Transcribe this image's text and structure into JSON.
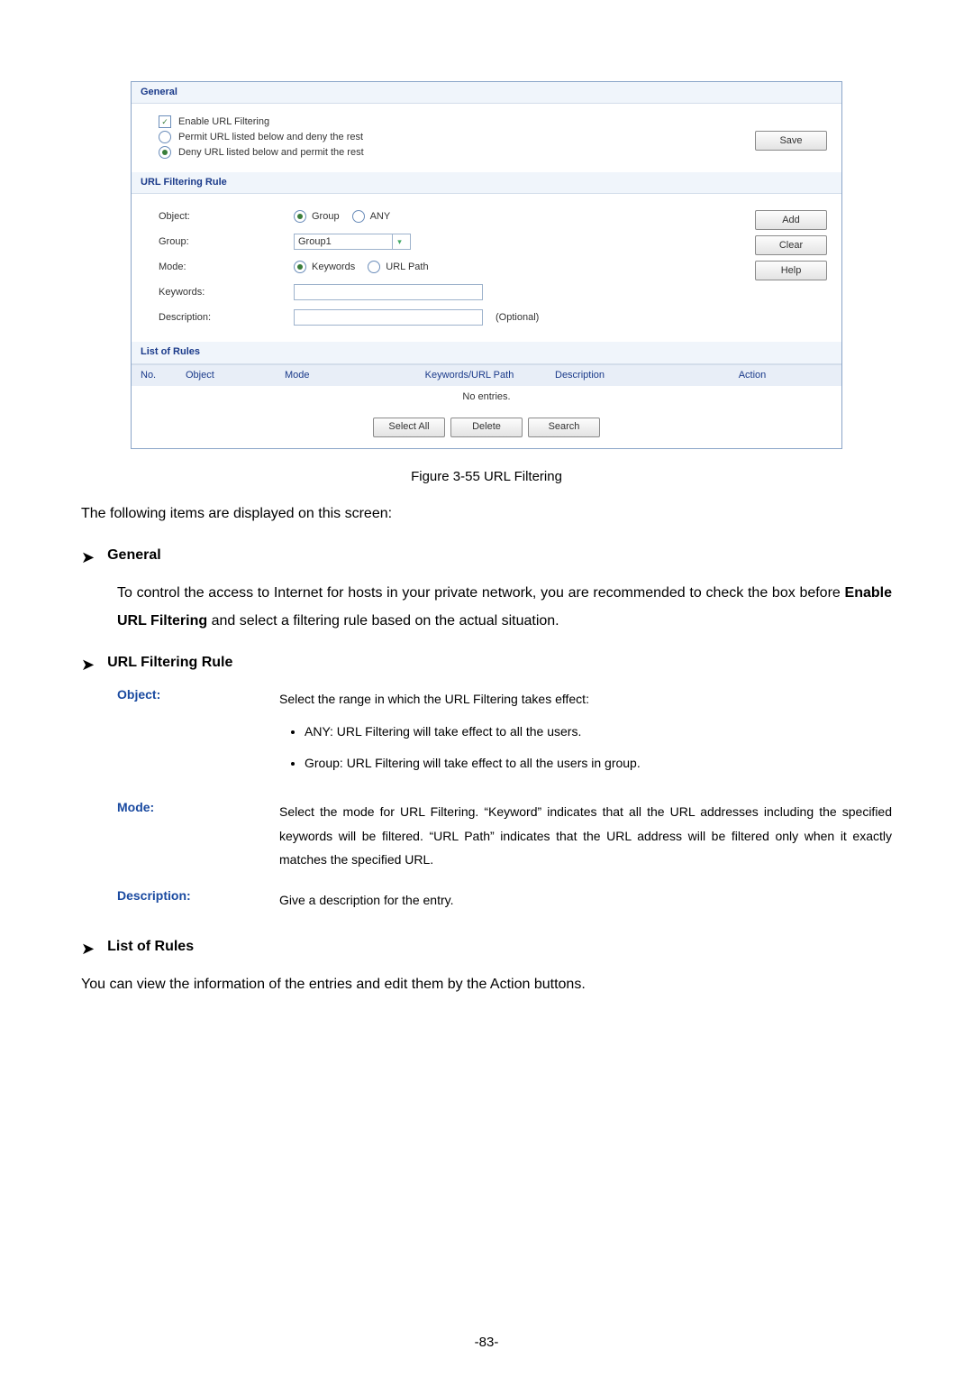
{
  "ui": {
    "sections": {
      "general": "General",
      "rule": "URL Filtering Rule",
      "list": "List of Rules"
    },
    "general": {
      "enable": "Enable URL Filtering",
      "permit": "Permit URL listed below and deny the rest",
      "deny": "Deny URL listed below and permit the rest",
      "save": "Save"
    },
    "rule": {
      "object_label": "Object:",
      "object_group": "Group",
      "object_any": "ANY",
      "group_label": "Group:",
      "group_value": "Group1",
      "mode_label": "Mode:",
      "mode_keywords": "Keywords",
      "mode_urlpath": "URL Path",
      "keywords_label": "Keywords:",
      "description_label": "Description:",
      "optional": "(Optional)",
      "add": "Add",
      "clear": "Clear",
      "help": "Help"
    },
    "list": {
      "cols": {
        "no": "No.",
        "object": "Object",
        "mode": "Mode",
        "kw": "Keywords/URL Path",
        "desc": "Description",
        "action": "Action"
      },
      "noentries": "No entries.",
      "selectall": "Select All",
      "delete": "Delete",
      "search": "Search"
    }
  },
  "doc": {
    "caption": "Figure 3-55 URL Filtering",
    "intro": "The following items are displayed on this screen:",
    "h_general": "General",
    "general_para_a": "To control the access to Internet for hosts in your private network, you are recommended to check the box before ",
    "general_para_b": "Enable URL Filtering",
    "general_para_c": " and select a filtering rule based on the actual situation.",
    "h_rule": "URL Filtering Rule",
    "object_label": "Object:",
    "object_desc": "Select the range in which the URL Filtering takes effect:",
    "object_opt1": "ANY: URL Filtering will take effect to all the users.",
    "object_opt2": "Group: URL Filtering will take effect to all the users in group.",
    "mode_label": "Mode:",
    "mode_desc": "Select the mode for URL Filtering. “Keyword” indicates that all the URL addresses including the specified keywords will be filtered. “URL Path” indicates that the URL address will be filtered only when it exactly matches the specified URL.",
    "desc_label": "Description:",
    "desc_desc": "Give a description for the entry.",
    "h_list": "List of Rules",
    "list_para": "You can view the information of the entries and edit them by the Action buttons.",
    "pagenum": "-83-"
  }
}
